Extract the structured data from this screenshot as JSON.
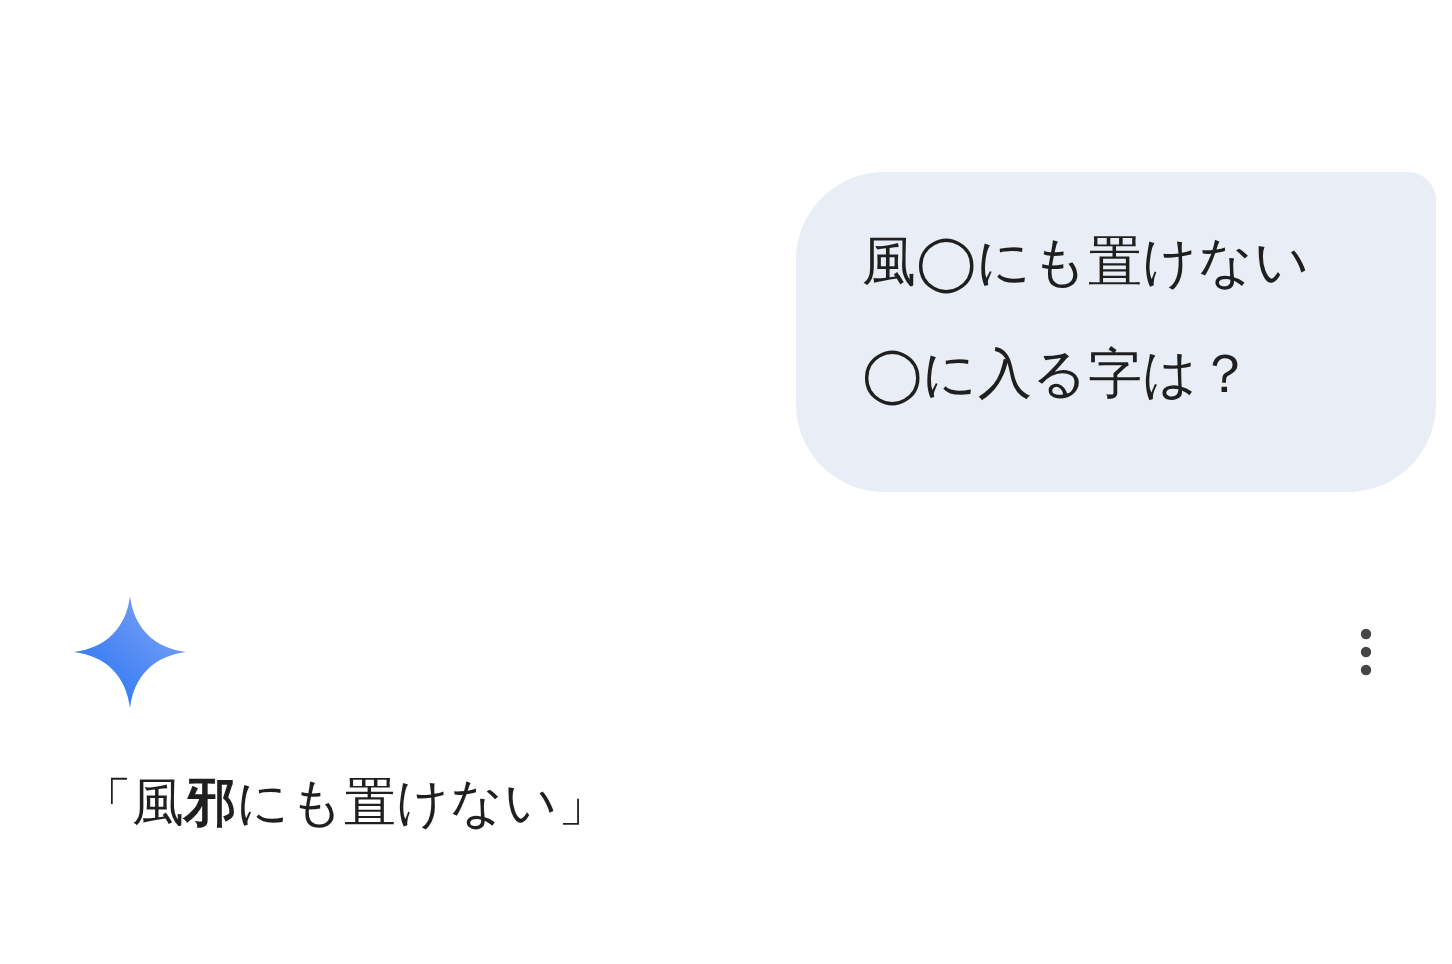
{
  "user_message": {
    "lines": [
      "風◯にも置けない",
      "◯に入る字は？"
    ]
  },
  "response": {
    "text": "「風**邪**にも置けない」"
  }
}
